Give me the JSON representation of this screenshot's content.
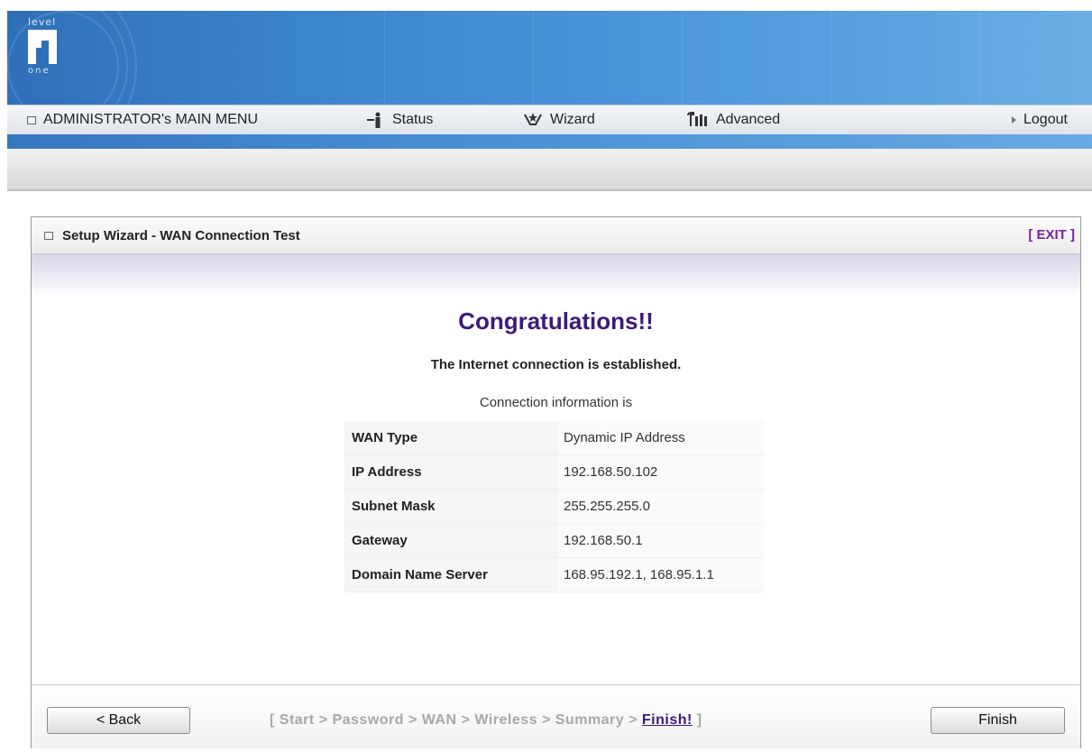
{
  "logo": {
    "top_text": "level",
    "bottom_text": "one"
  },
  "menu": {
    "main": "ADMINISTRATOR's MAIN MENU",
    "status": "Status",
    "wizard": "Wizard",
    "advanced": "Advanced",
    "logout": "Logout"
  },
  "panel": {
    "title": "Setup Wizard - WAN Connection Test",
    "exit": "[ EXIT ]",
    "congrats": "Congratulations!!",
    "established": "The Internet connection is established.",
    "conn_info": "Connection information is",
    "rows": [
      {
        "label": "WAN Type",
        "value": "Dynamic IP Address"
      },
      {
        "label": "IP Address",
        "value": "192.168.50.102"
      },
      {
        "label": "Subnet Mask",
        "value": "255.255.255.0"
      },
      {
        "label": "Gateway",
        "value": "192.168.50.1"
      },
      {
        "label": "Domain Name Server",
        "value": "168.95.192.1, 168.95.1.1"
      }
    ]
  },
  "footer": {
    "back": "< Back",
    "finish": "Finish",
    "steps_prefix": "[ Start > Password > WAN > Wireless > Summary > ",
    "steps_current": "Finish!",
    "steps_suffix": " ]"
  },
  "icons": {
    "menu_square": "square-icon",
    "status": "status-person-icon",
    "wizard": "wizard-icon",
    "advanced": "advanced-icon",
    "logout": "arrow-right-icon"
  }
}
